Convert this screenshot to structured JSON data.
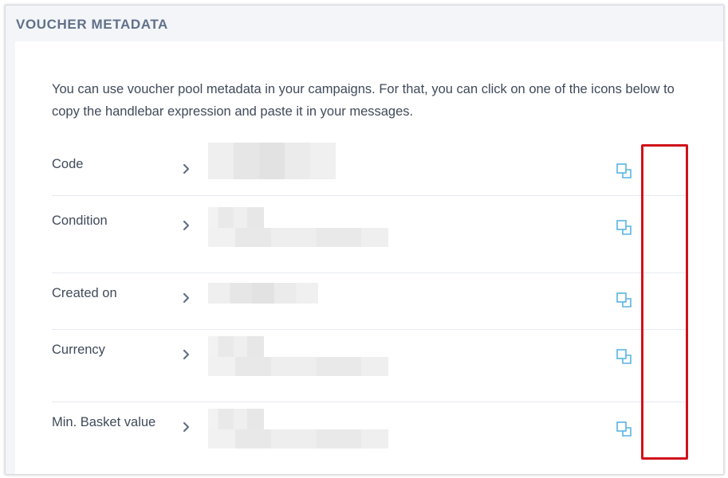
{
  "section": {
    "title": "VOUCHER METADATA",
    "intro": "You can use voucher pool metadata in your campaigns. For that, you can click on one of the icons below to copy the handlebar expression and paste it in your messages."
  },
  "rows": [
    {
      "label": "Code",
      "icon": "copy-icon"
    },
    {
      "label": "Condition",
      "icon": "copy-icon"
    },
    {
      "label": "Created on",
      "icon": "copy-icon"
    },
    {
      "label": "Currency",
      "icon": "copy-icon"
    },
    {
      "label": "Min. Basket value",
      "icon": "copy-icon"
    }
  ],
  "colors": {
    "title": "#61708a",
    "text": "#3f4a5a",
    "icon": "#58b4e3",
    "highlight": "#d0121b"
  }
}
